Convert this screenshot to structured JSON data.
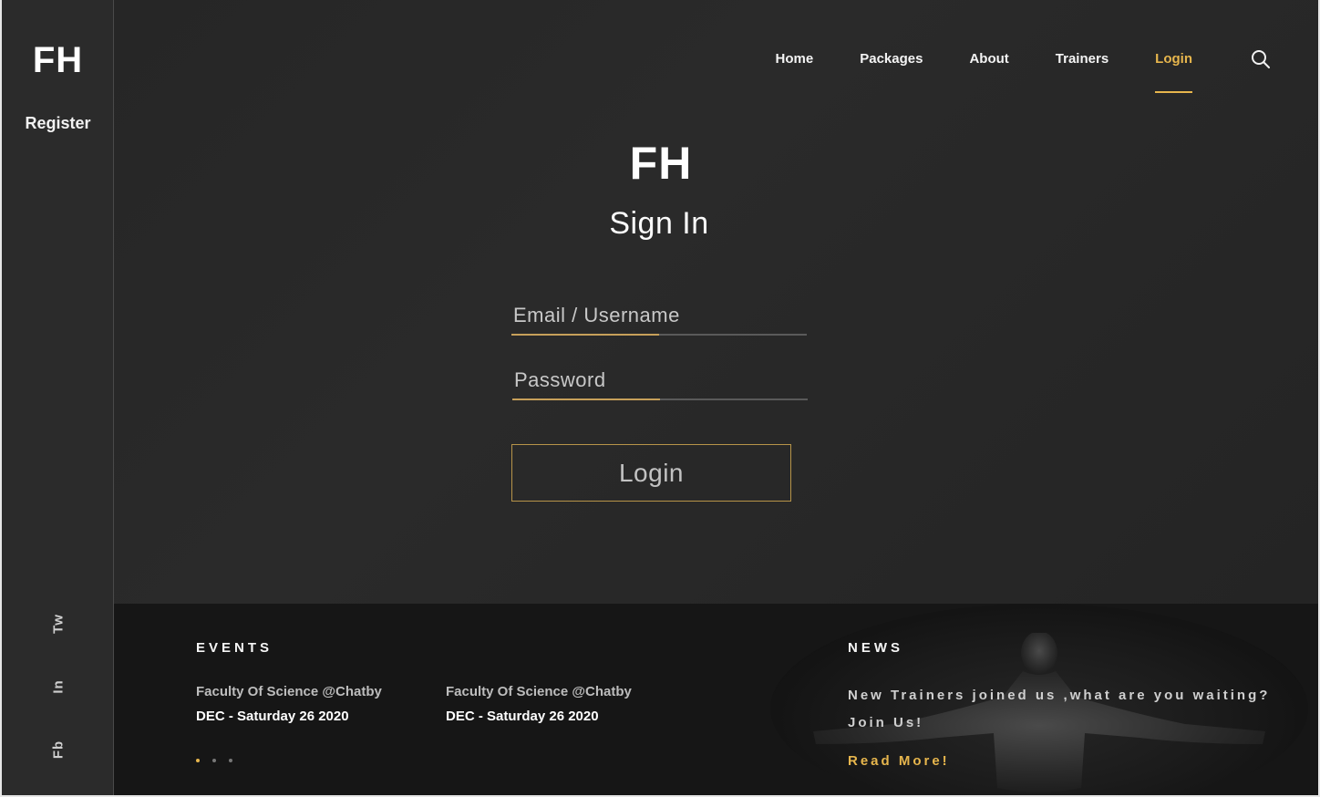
{
  "sidebar": {
    "brand": "FH",
    "register_label": "Register",
    "social": [
      "Tw",
      "In",
      "Fb"
    ]
  },
  "nav": {
    "items": [
      {
        "label": "Home",
        "active": false
      },
      {
        "label": "Packages",
        "active": false
      },
      {
        "label": "About",
        "active": false
      },
      {
        "label": "Trainers",
        "active": false
      },
      {
        "label": "Login",
        "active": true
      }
    ],
    "search_icon": "search-icon"
  },
  "hero": {
    "logo": "FH",
    "title": "Sign In"
  },
  "form": {
    "email_placeholder": "Email / Username",
    "email_value": "",
    "password_placeholder": "Password",
    "password_value": "",
    "login_label": "Login"
  },
  "footer": {
    "events_title": "EVENTS",
    "events": [
      {
        "place": "Faculty Of Science @Chatby",
        "date": "DEC - Saturday 26 2020"
      },
      {
        "place": "Faculty Of Science @Chatby",
        "date": "DEC - Saturday 26 2020"
      }
    ],
    "news_title": "NEWS",
    "news_text_line1": "New Trainers joined us ,what are you waiting?",
    "news_text_line2": "Join Us!",
    "read_more": "Read More!"
  },
  "colors": {
    "accent": "#e7b64d",
    "background": "#2a2a2a",
    "footer_background": "#161616"
  }
}
